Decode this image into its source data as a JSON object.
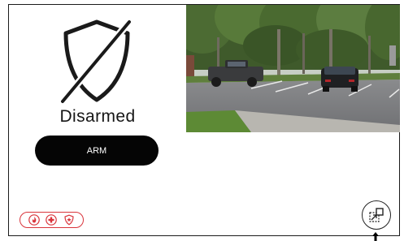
{
  "security_panel": {
    "status_label": "Disarmed",
    "arm_button_label": "ARM",
    "shield_icon": "shield-off-icon"
  },
  "camera_feed": {
    "scene": "parking-lot-live-view"
  },
  "alert_indicators": {
    "icons": [
      "fire-icon",
      "medical-icon",
      "police-icon"
    ],
    "color": "#d9343b"
  },
  "controls": {
    "expand_icon": "expand-view-icon"
  },
  "colors": {
    "button_bg": "#050505",
    "alert": "#d9343b",
    "border": "#1b1b1b"
  }
}
